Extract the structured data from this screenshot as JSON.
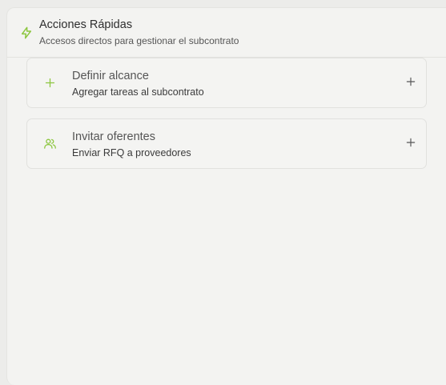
{
  "header": {
    "icon": "lightning-icon",
    "title": "Acciones Rápidas",
    "subtitle": "Accesos directos para gestionar el subcontrato"
  },
  "actions": [
    {
      "icon": "plus-icon",
      "title": "Definir alcance",
      "description": "Agregar tareas al subcontrato",
      "trailing_icon": "plus-icon"
    },
    {
      "icon": "users-icon",
      "title": "Invitar oferentes",
      "description": "Enviar RFQ a proveedores",
      "trailing_icon": "plus-icon"
    }
  ],
  "colors": {
    "accent": "#8cc63f",
    "panel_bg": "#f3f3f1",
    "text_dark": "#2e2e2e"
  }
}
